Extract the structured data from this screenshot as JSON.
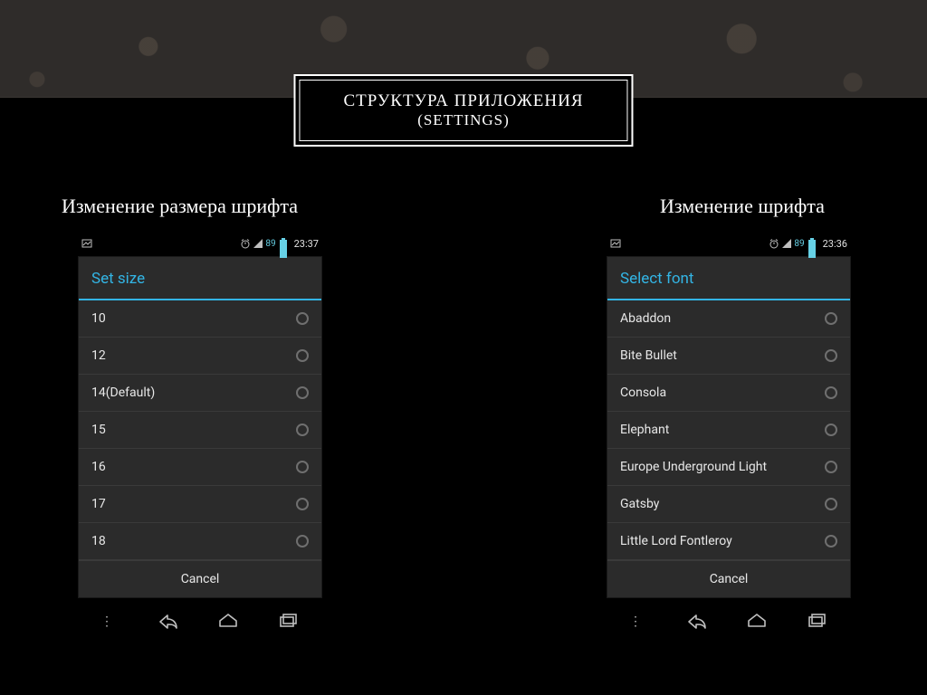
{
  "slide_title": {
    "line1": "СТРУКТУРА ПРИЛОЖЕНИЯ",
    "line2": "(SETTINGS)"
  },
  "left": {
    "caption": "Изменение размера шрифта",
    "statusbar": {
      "battery": "89",
      "time": "23:37"
    },
    "dialog": {
      "title": "Set size",
      "options": [
        "10",
        "12",
        "14(Default)",
        "15",
        "16",
        "17",
        "18"
      ],
      "cancel": "Cancel"
    }
  },
  "right": {
    "caption": "Изменение шрифта",
    "statusbar": {
      "battery": "89",
      "time": "23:36"
    },
    "dialog": {
      "title": "Select font",
      "options": [
        "Abaddon",
        "Bite Bullet",
        "Consola",
        "Elephant",
        "Europe Underground Light",
        "Gatsby",
        "Little Lord Fontleroy"
      ],
      "cancel": "Cancel"
    }
  }
}
